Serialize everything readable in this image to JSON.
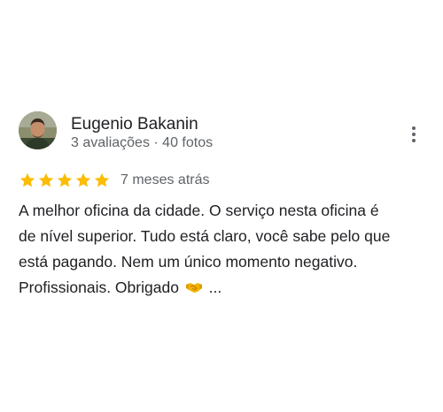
{
  "review": {
    "author": {
      "name": "Eugenio Bakanin",
      "meta": "3 avaliações · 40 fotos",
      "avatar": "avatar-photo"
    },
    "more_icon": "more-vert-icon",
    "rating": {
      "value": 5,
      "max": 5,
      "star_color": "#fbbc04",
      "star_icon": "star-icon"
    },
    "time": "7 meses atrás",
    "text_lines": [
      "A melhor oficina da cidade.  O serviço nesta oficina é",
      "de nível superior.  Tudo está claro, você sabe pelo que",
      "está pagando.  Nem um único momento negativo.",
      "Profissionais. Obrigado"
    ],
    "emoji_icon": "handshake-icon",
    "ellipsis": "..."
  },
  "colors": {
    "text_primary": "#202124",
    "text_secondary": "#5f6368",
    "background": "#ffffff"
  }
}
